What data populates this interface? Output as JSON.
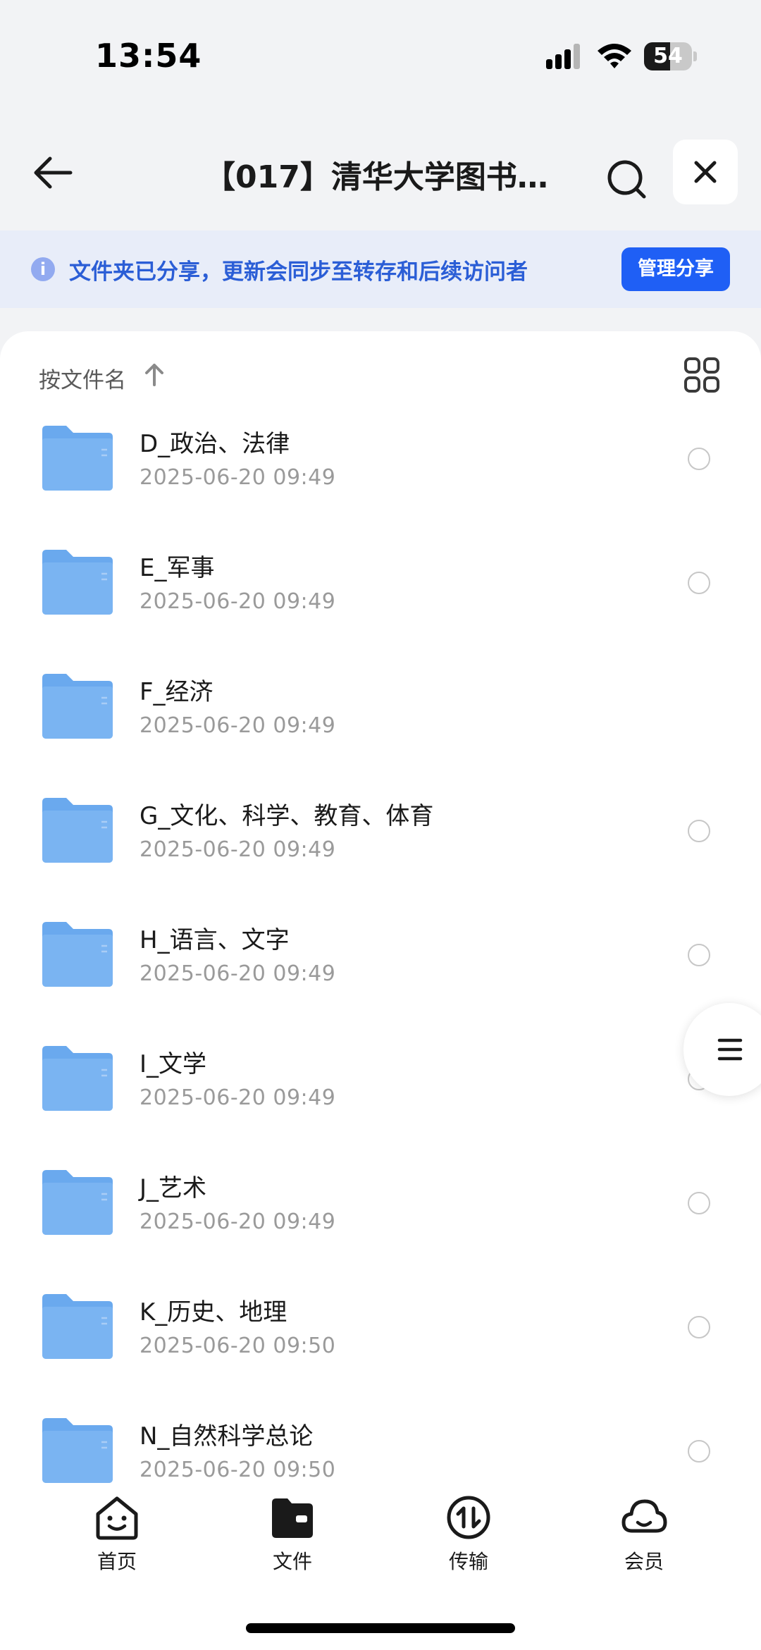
{
  "status_bar": {
    "time": "13:54",
    "battery_level": "54",
    "battery_fraction": 0.54,
    "icons": [
      "cellular-signal-icon",
      "wifi-icon",
      "battery-icon"
    ]
  },
  "header": {
    "title": "【017】清华大学图书…",
    "icons": [
      "back-arrow-icon",
      "search-icon",
      "close-icon"
    ]
  },
  "share_banner": {
    "message": "文件夹已分享，更新会同步至转存和后续访问者",
    "manage_button": "管理分享"
  },
  "sort_bar": {
    "label": "按文件名",
    "direction": "ascending"
  },
  "files": [
    {
      "name": "D_政治、法律",
      "date": "2025-06-20 09:49"
    },
    {
      "name": "E_军事",
      "date": "2025-06-20 09:49"
    },
    {
      "name": "F_经济",
      "date": "2025-06-20 09:49"
    },
    {
      "name": "G_文化、科学、教育、体育",
      "date": "2025-06-20 09:49"
    },
    {
      "name": "H_语言、文字",
      "date": "2025-06-20 09:49"
    },
    {
      "name": "I_文学",
      "date": "2025-06-20 09:49"
    },
    {
      "name": "J_艺术",
      "date": "2025-06-20 09:49"
    },
    {
      "name": "K_历史、地理",
      "date": "2025-06-20 09:50"
    },
    {
      "name": "N_自然科学总论",
      "date": "2025-06-20 09:50"
    }
  ],
  "tabs": [
    {
      "label": "首页",
      "icon": "smiley-home-icon"
    },
    {
      "label": "文件",
      "icon": "folder-icon"
    },
    {
      "label": "传输",
      "icon": "transfer-icon"
    },
    {
      "label": "会员",
      "icon": "cloud-member-icon"
    }
  ],
  "colors": {
    "accent": "#1f5ff5",
    "banner_bg": "#e8edf9",
    "banner_text": "#2b5ed6",
    "folder": "#7cb6f2"
  }
}
